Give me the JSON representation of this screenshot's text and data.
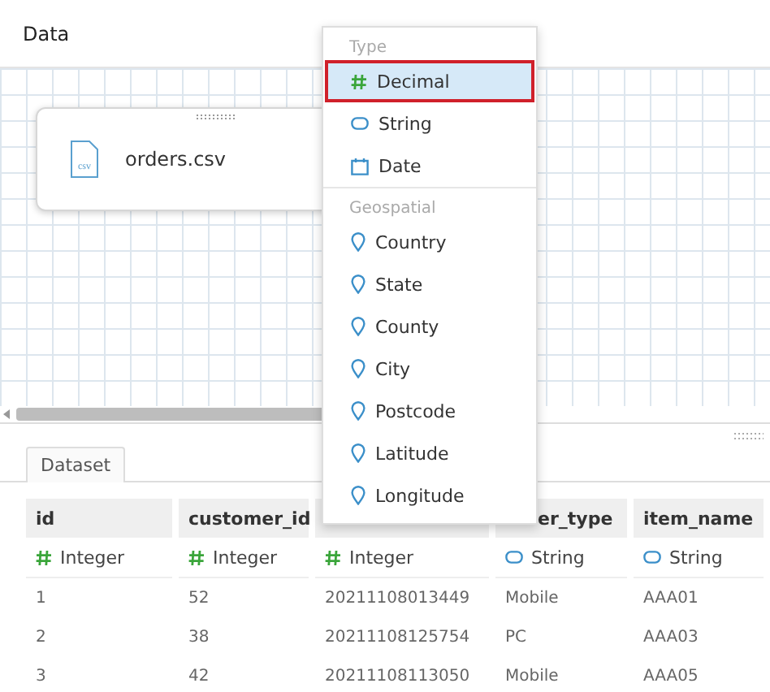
{
  "header": {
    "title": "Data"
  },
  "canvas": {
    "source": {
      "file": "orders.csv",
      "icon_label": "csv"
    }
  },
  "tabs": [
    {
      "label": "Dataset",
      "selected": true
    }
  ],
  "table": {
    "columns": [
      {
        "label": "id",
        "type": "Integer",
        "kind": "number"
      },
      {
        "label": "customer_id",
        "type": "Integer",
        "kind": "number"
      },
      {
        "type": "Integer",
        "kind": "number"
      },
      {
        "label": "er_type",
        "type": "String",
        "kind": "string",
        "clipped": true
      },
      {
        "label": "item_name",
        "type": "String",
        "kind": "string"
      }
    ],
    "rows": [
      [
        "1",
        "52",
        "20211108013449",
        "Mobile",
        "AAA01"
      ],
      [
        "2",
        "38",
        "20211108125754",
        "PC",
        "AAA03"
      ],
      [
        "3",
        "42",
        "20211108113050",
        "Mobile",
        "AAA05"
      ]
    ]
  },
  "menu": {
    "sections": [
      {
        "heading": "Type",
        "items": [
          {
            "label": "Decimal",
            "kind": "number",
            "selected": true
          },
          {
            "label": "String",
            "kind": "string",
            "selected": false
          },
          {
            "label": "Date",
            "kind": "date",
            "selected": false
          }
        ]
      },
      {
        "heading": "Geospatial",
        "items": [
          {
            "label": "Country",
            "kind": "geo",
            "selected": false
          },
          {
            "label": "State",
            "kind": "geo",
            "selected": false
          },
          {
            "label": "County",
            "kind": "geo",
            "selected": false
          },
          {
            "label": "City",
            "kind": "geo",
            "selected": false
          },
          {
            "label": "Postcode",
            "kind": "geo",
            "selected": false
          },
          {
            "label": "Latitude",
            "kind": "geo",
            "selected": false
          },
          {
            "label": "Longitude",
            "kind": "geo",
            "selected": false
          }
        ]
      }
    ]
  }
}
